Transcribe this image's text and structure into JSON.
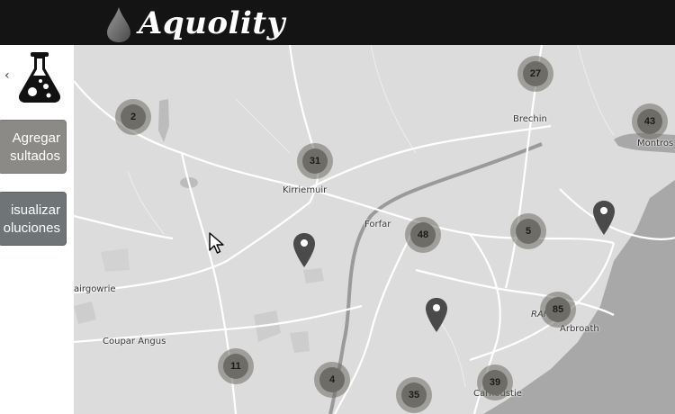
{
  "app": {
    "brand": "Aquolity"
  },
  "sidebar": {
    "collapse_icon": "chevron-left-icon",
    "logo_icon": "flask-icon",
    "buttons": [
      {
        "line1": "Agregar",
        "line2": "sultados"
      },
      {
        "line1": "isualizar",
        "line2": "oluciones"
      }
    ]
  },
  "map": {
    "places": [
      "Brechin",
      "Montros",
      "Kirriemuir",
      "Forfar",
      "airgowrie",
      "Coupar Angus",
      "Arbroath",
      "Carnoustie",
      "RAF"
    ],
    "clusters": [
      "27",
      "2",
      "43",
      "31",
      "48",
      "5",
      "85",
      "11",
      "4",
      "39",
      "35"
    ],
    "pins": 3,
    "colors": {
      "cluster": "#6e6c66",
      "pin": "#4a4a4a",
      "land": "#dcdcdc",
      "sea": "#a8a8a8"
    }
  }
}
